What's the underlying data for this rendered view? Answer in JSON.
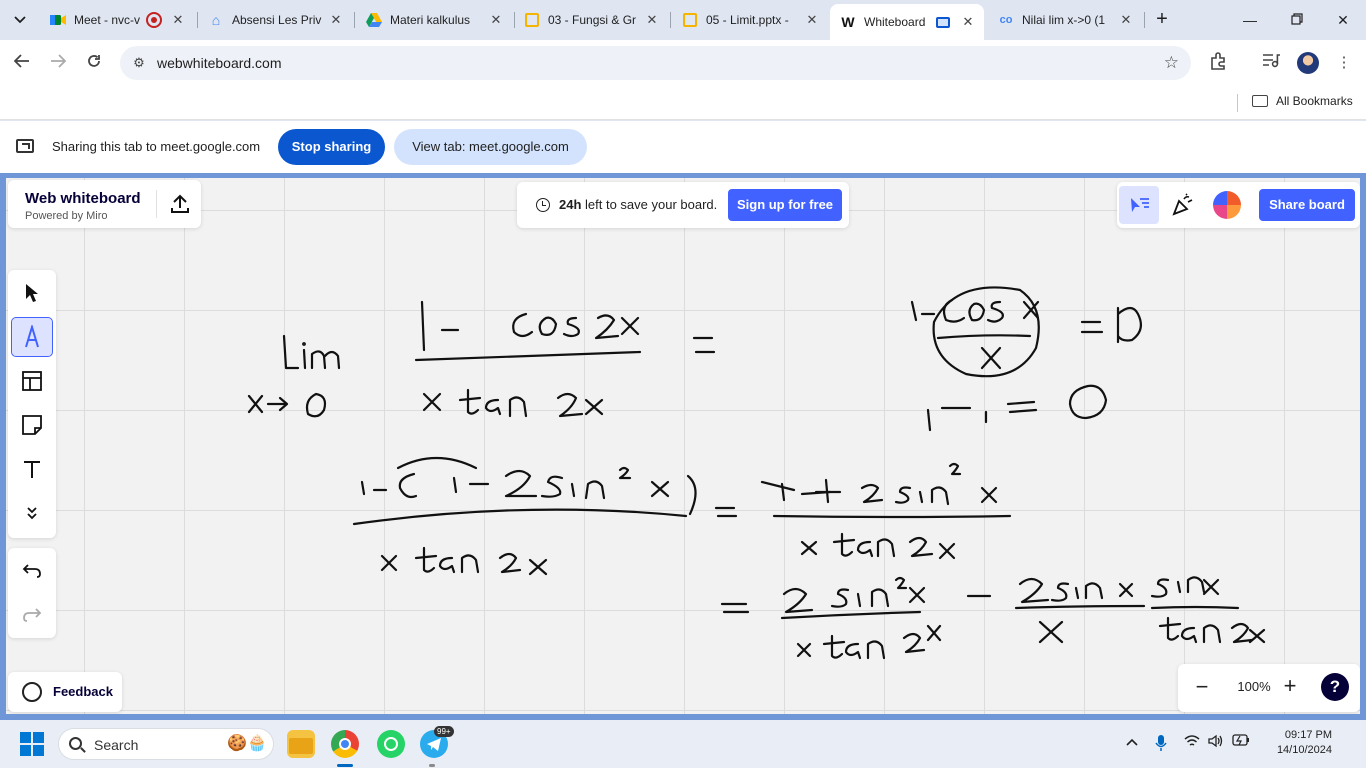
{
  "browser": {
    "tabs": [
      {
        "title": "Meet - nvc-v",
        "favicon": "meet-icon",
        "active": false
      },
      {
        "title": "Absensi Les Priv",
        "favicon": "home-icon",
        "active": false
      },
      {
        "title": "Materi kalkulus",
        "favicon": "drive-icon",
        "active": false
      },
      {
        "title": "03 - Fungsi & Gr",
        "favicon": "slides-icon",
        "active": false
      },
      {
        "title": "05 - Limit.pptx -",
        "favicon": "slides-icon",
        "active": false
      },
      {
        "title": "Whiteboard",
        "favicon": "whiteboard-icon",
        "active": true
      },
      {
        "title": "Nilai lim x->0 (1",
        "favicon": "co-icon",
        "active": false
      }
    ],
    "url": "webwhiteboard.com",
    "bookmarks_label": "All Bookmarks"
  },
  "sharing": {
    "text": "Sharing this tab to meet.google.com",
    "stop_label": "Stop sharing",
    "view_label": "View tab: meet.google.com"
  },
  "whiteboard": {
    "brand_title": "Web whiteboard",
    "brand_sub": "Powered by Miro",
    "save_hours": "24h",
    "save_rest": " left to save your board.",
    "signup_label": "Sign up for free",
    "share_label": "Share board",
    "zoom": "100%",
    "help_label": "?",
    "feedback_label": "Feedback",
    "tools": [
      "select-tool",
      "pen-tool",
      "template-tool",
      "sticky-note-tool",
      "text-tool",
      "more-tools"
    ],
    "selected_tool": "pen-tool",
    "accent": "#4262ff"
  },
  "taskbar": {
    "search_label": "Search",
    "badge": "99+",
    "time": "09:17 PM",
    "date": "14/10/2024"
  }
}
